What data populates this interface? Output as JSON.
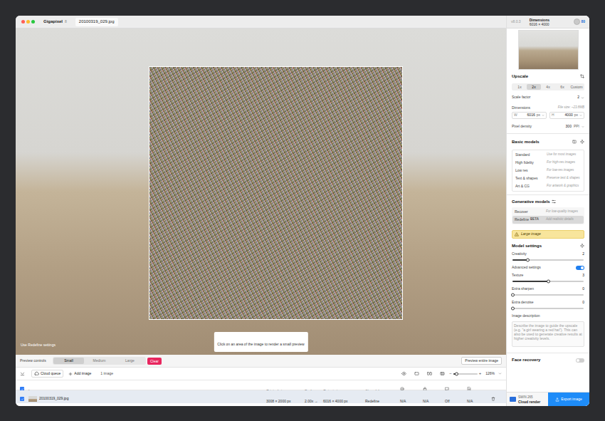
{
  "window": {
    "app_name": "Gigapixel",
    "app_badge": "8",
    "file_name": "20100319_029.jpg",
    "version": "v8.0.3",
    "dimensions_label": "Dimensions",
    "dimensions": "6016 × 4000",
    "credits": "80"
  },
  "canvas": {
    "settings_label": "Use Redefine settings",
    "hint": "Click on an area of the image to render a small preview"
  },
  "preview_controls": {
    "label": "Preview controls",
    "sizes": [
      {
        "label": "Small",
        "selected": true
      },
      {
        "label": "Medium",
        "selected": false
      },
      {
        "label": "Large",
        "selected": false
      }
    ],
    "clear": "Clear",
    "preview_entire": "Preview entire image"
  },
  "toolbar": {
    "cloud_queue": "Cloud queue",
    "add_image": "Add image",
    "count": "1 image",
    "zoom_out": "−",
    "zoom_in": "+",
    "zoom": {
      "level": 0.15,
      "reading": "126%"
    }
  },
  "table": {
    "all_checked": true,
    "columns": [
      "Image",
      "Original size",
      "Scale",
      "Output size",
      "AI model"
    ],
    "rows": [
      {
        "checked": true,
        "selected": true,
        "cells": [
          "20100319_029.jpg",
          "3008 × 2000 px",
          "2.00x →",
          "6016 × 4000 px",
          "Redefine",
          "N/A",
          "N/A",
          "Off",
          "N/A"
        ]
      }
    ]
  },
  "sidebar": {
    "upscale": {
      "title": "Upscale",
      "scales": [
        {
          "label": "1x",
          "selected": false
        },
        {
          "label": "2x",
          "selected": true
        },
        {
          "label": "4x",
          "selected": false
        },
        {
          "label": "6x",
          "selected": false
        },
        {
          "label": "Custom",
          "selected": false
        }
      ],
      "scale_factor_label": "Scale factor",
      "scale_factor": "2",
      "dimensions_label": "Dimensions",
      "file_size": "File size: ~23.8MB",
      "width_label": "W",
      "width": "6016",
      "width_unit": "px",
      "height_label": "H",
      "height": "4000",
      "height_unit": "px",
      "pixel_density_label": "Pixel density",
      "pixel_density": "300",
      "pixel_density_unit": "PPI"
    },
    "basic_models": {
      "title": "Basic models",
      "items": [
        {
          "name": "Standard",
          "description": "Use for most images",
          "selected": false
        },
        {
          "name": "High fidelity",
          "description": "For high-res images",
          "selected": false
        },
        {
          "name": "Low res",
          "description": "For low-res images",
          "selected": false
        },
        {
          "name": "Text & shapes",
          "description": "Preserve text & shapes",
          "selected": false
        },
        {
          "name": "Art & CG",
          "description": "For artwork & graphics",
          "selected": false
        }
      ]
    },
    "generative_models": {
      "title": "Generative models",
      "items": [
        {
          "name": "Recover",
          "description": "For low-quality images",
          "selected": false
        },
        {
          "name": "Redefine",
          "badge": "BETA",
          "description": "Add realistic details",
          "selected": true
        }
      ]
    },
    "warning": "Large image",
    "model_settings": {
      "title": "Model settings",
      "controls": [
        {
          "kind": "slider",
          "label": "Creativity",
          "reading": "2",
          "level": 0.21
        },
        {
          "kind": "toggle",
          "label": "Advanced settings",
          "on": true
        },
        {
          "kind": "slider",
          "label": "Texture",
          "reading": "3",
          "level": 0.5
        },
        {
          "kind": "slider",
          "label": "Extra sharpen",
          "reading": "0",
          "level": 0
        },
        {
          "kind": "slider",
          "label": "Extra denoise",
          "reading": "0",
          "level": 0
        }
      ]
    },
    "image_description": {
      "label": "Image description",
      "placeholder": "Describe the image to guide the upscale (e.g. \"a girl wearing a red hat\"). This can also be used to generate creative results at higher creativity levels."
    },
    "face_recovery": {
      "label": "Face recovery",
      "on": false
    }
  },
  "footer": {
    "codec": "SWIN 265",
    "mode": "Cloud render",
    "export": "Export image"
  }
}
